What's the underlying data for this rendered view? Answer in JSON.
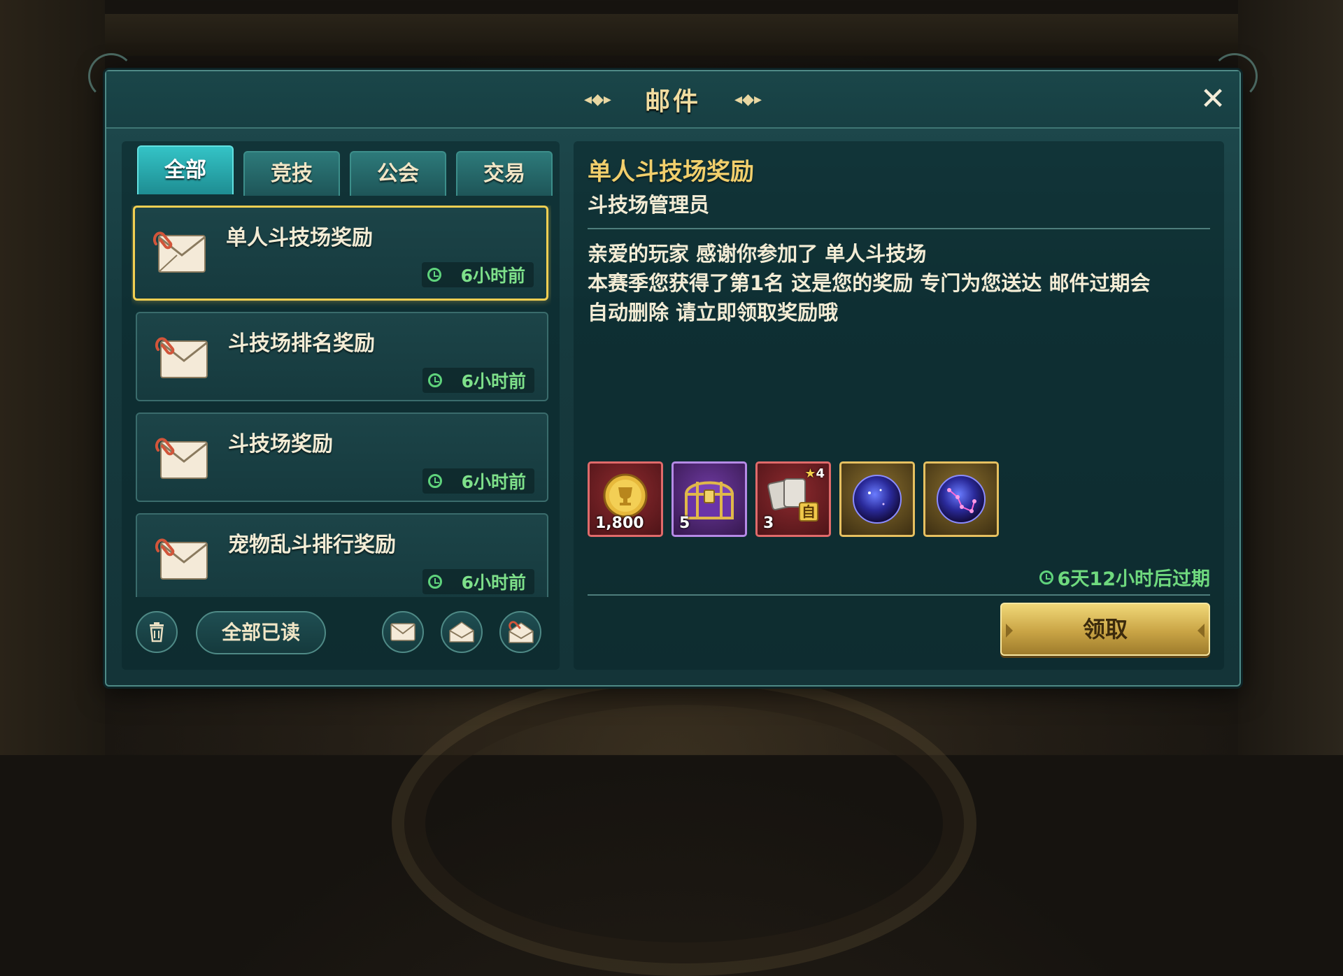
{
  "window": {
    "title": "邮件"
  },
  "tabs": [
    {
      "label": "全部",
      "active": true
    },
    {
      "label": "竞技",
      "active": false
    },
    {
      "label": "公会",
      "active": false
    },
    {
      "label": "交易",
      "active": false
    }
  ],
  "mails": [
    {
      "title": "单人斗技场奖励",
      "time": "6小时前",
      "selected": true
    },
    {
      "title": "斗技场排名奖励",
      "time": "6小时前",
      "selected": false
    },
    {
      "title": "斗技场奖励",
      "time": "6小时前",
      "selected": false
    },
    {
      "title": "宠物乱斗排行奖励",
      "time": "6小时前",
      "selected": false
    }
  ],
  "footer": {
    "mark_all_read": "全部已读",
    "icons": [
      "trash-icon",
      "envelope-closed-icon",
      "envelope-open-icon",
      "envelope-attachment-icon"
    ]
  },
  "detail": {
    "title": "单人斗技场奖励",
    "sender": "斗技场管理员",
    "body_lines": [
      "亲爱的玩家 感谢你参加了 单人斗技场",
      "本赛季您获得了第1名 这是您的奖励 专门为您送达 邮件过期会",
      "自动删除 请立即领取奖励哦"
    ],
    "rewards": [
      {
        "icon": "gold-trophy-coin-icon",
        "count": "1,800",
        "rarity_color": "#e06a6a"
      },
      {
        "icon": "treasure-chest-icon",
        "count": "5",
        "rarity_color": "#b58ae6"
      },
      {
        "icon": "stone-tablet-icon",
        "count": "3",
        "star": "4",
        "badge": "自",
        "rarity_color": "#e06a6a"
      },
      {
        "icon": "nebula-orb-icon",
        "count": "",
        "rarity_color": "#e6c060"
      },
      {
        "icon": "constellation-orb-icon",
        "count": "",
        "rarity_color": "#e6c060"
      }
    ],
    "expire": "6天12小时后过期",
    "claim_label": "领取"
  }
}
